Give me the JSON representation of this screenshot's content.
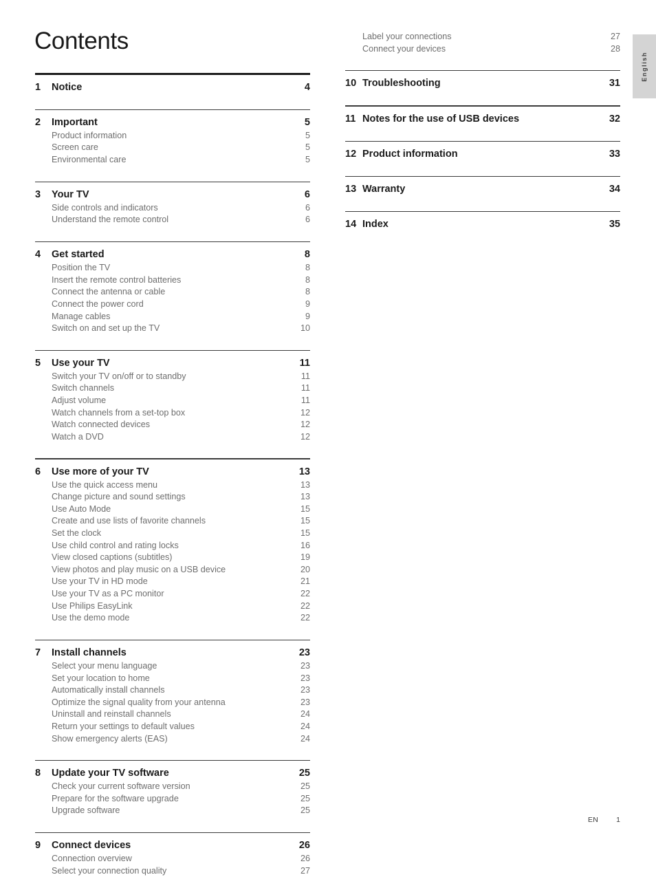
{
  "document": {
    "title": "Contents",
    "language_tab": "English",
    "footer": {
      "locale_code": "EN",
      "page_number": "1"
    }
  },
  "columns": {
    "left": {
      "groups": [
        {
          "rule": "thick",
          "heading": {
            "number": "1",
            "label": "Notice",
            "page": "4"
          },
          "items": []
        },
        {
          "rule": "thin",
          "heading": {
            "number": "2",
            "label": "Important",
            "page": "5"
          },
          "items": [
            {
              "label": "Product information",
              "page": "5"
            },
            {
              "label": "Screen care",
              "page": "5"
            },
            {
              "label": "Environmental care",
              "page": "5"
            }
          ]
        },
        {
          "rule": "thin",
          "heading": {
            "number": "3",
            "label": "Your TV",
            "page": "6"
          },
          "items": [
            {
              "label": "Side controls and indicators",
              "page": "6"
            },
            {
              "label": "Understand the remote control",
              "page": "6"
            }
          ]
        },
        {
          "rule": "thin",
          "heading": {
            "number": "4",
            "label": "Get started",
            "page": "8"
          },
          "items": [
            {
              "label": "Position the TV",
              "page": "8"
            },
            {
              "label": "Insert the remote control batteries",
              "page": "8"
            },
            {
              "label": "Connect the antenna or cable",
              "page": "8"
            },
            {
              "label": "Connect the power cord",
              "page": "9"
            },
            {
              "label": "Manage cables",
              "page": "9"
            },
            {
              "label": "Switch on and set up the TV",
              "page": "10"
            }
          ]
        },
        {
          "rule": "thin",
          "heading": {
            "number": "5",
            "label": "Use your TV",
            "page": "11"
          },
          "items": [
            {
              "label": "Switch your TV on/off or to standby",
              "page": "11"
            },
            {
              "label": "Switch channels",
              "page": "11"
            },
            {
              "label": "Adjust volume",
              "page": "11"
            },
            {
              "label": "Watch channels from a set-top box",
              "page": "12"
            },
            {
              "label": "Watch connected devices",
              "page": "12"
            },
            {
              "label": "Watch a DVD",
              "page": "12"
            }
          ]
        },
        {
          "rule": "thin",
          "heading": {
            "number": "6",
            "label": "Use more of your TV",
            "page": "13"
          },
          "items": [
            {
              "label": "Use the quick access menu",
              "page": "13"
            },
            {
              "label": "Change picture and sound settings",
              "page": "13"
            },
            {
              "label": "Use Auto Mode",
              "page": "15"
            },
            {
              "label": "Create and use lists of favorite channels",
              "page": "15"
            },
            {
              "label": "Set the clock",
              "page": "15"
            },
            {
              "label": "Use child control and rating locks",
              "page": "16"
            },
            {
              "label": "View closed captions (subtitles)",
              "page": "19"
            },
            {
              "label": "View photos and play music on a USB device",
              "page": "20"
            },
            {
              "label": "Use your TV in HD mode",
              "page": "21"
            },
            {
              "label": "Use your TV as a PC monitor",
              "page": "22"
            },
            {
              "label": "Use Philips EasyLink",
              "page": "22"
            },
            {
              "label": "Use the demo mode",
              "page": "22"
            }
          ]
        },
        {
          "rule": "thin",
          "heading": {
            "number": "7",
            "label": "Install channels",
            "page": "23"
          },
          "items": [
            {
              "label": "Select your menu language",
              "page": "23"
            },
            {
              "label": "Set your location to home",
              "page": "23"
            },
            {
              "label": "Automatically install channels",
              "page": "23"
            },
            {
              "label": "Optimize the signal quality from your antenna",
              "page": "23"
            },
            {
              "label": "Uninstall and reinstall channels",
              "page": "24"
            },
            {
              "label": "Return your settings to default values",
              "page": "24"
            },
            {
              "label": "Show emergency alerts (EAS)",
              "page": "24"
            }
          ]
        },
        {
          "rule": "thin",
          "heading": {
            "number": "8",
            "label": "Update your TV software",
            "page": "25"
          },
          "items": [
            {
              "label": "Check your current software version",
              "page": "25"
            },
            {
              "label": "Prepare for the software upgrade",
              "page": "25"
            },
            {
              "label": "Upgrade software",
              "page": "25"
            }
          ]
        },
        {
          "rule": "thin",
          "heading": {
            "number": "9",
            "label": "Connect devices",
            "page": "26"
          },
          "items": [
            {
              "label": "Connection overview",
              "page": "26"
            },
            {
              "label": "Select your connection quality",
              "page": "27"
            }
          ]
        }
      ]
    },
    "right": {
      "continued_items": [
        {
          "label": "Label your connections",
          "page": "27"
        },
        {
          "label": "Connect your devices",
          "page": "28"
        }
      ],
      "groups": [
        {
          "rule": "thin",
          "heading": {
            "number": "10",
            "label": "Troubleshooting",
            "page": "31"
          },
          "items": []
        },
        {
          "rule": "thin",
          "heading": {
            "number": "11",
            "label": "Notes for the use of USB devices",
            "page": "32"
          },
          "items": []
        },
        {
          "rule": "thin",
          "heading": {
            "number": "12",
            "label": "Product information",
            "page": "33"
          },
          "items": []
        },
        {
          "rule": "thin",
          "heading": {
            "number": "13",
            "label": "Warranty",
            "page": "34"
          },
          "items": []
        },
        {
          "rule": "thin",
          "heading": {
            "number": "14",
            "label": "Index",
            "page": "35"
          },
          "items": []
        }
      ]
    }
  }
}
